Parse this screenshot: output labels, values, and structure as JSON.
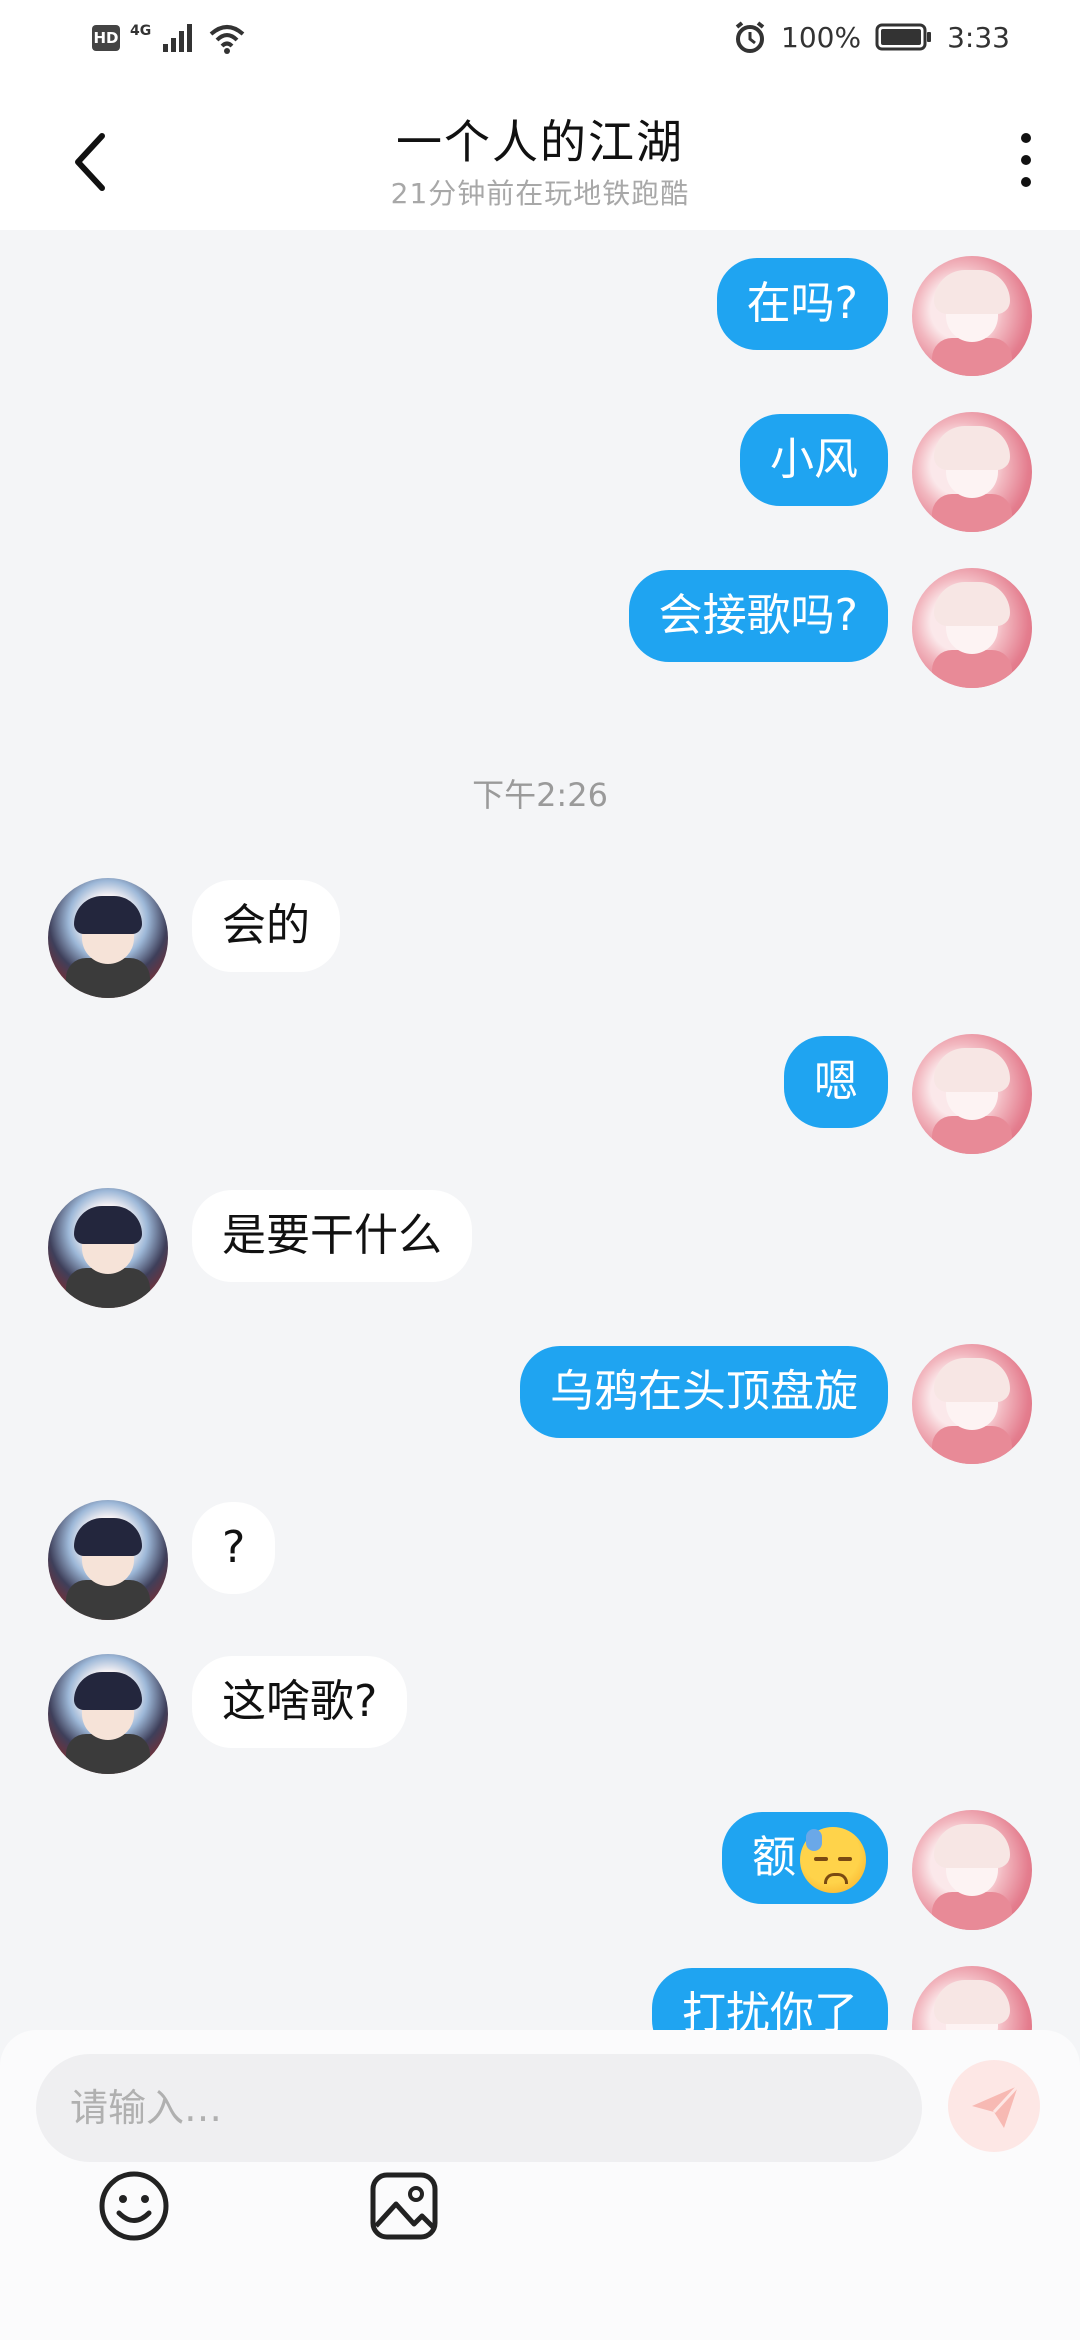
{
  "status_bar": {
    "hd": "HD",
    "network": "4G",
    "battery": "100%",
    "time": "3:33"
  },
  "header": {
    "title": "一个人的江湖",
    "subtitle": "21分钟前在玩地铁跑酷"
  },
  "messages": [
    {
      "side": "self",
      "text": "在吗?"
    },
    {
      "side": "self",
      "text": "小风"
    },
    {
      "side": "self",
      "text": "会接歌吗?"
    },
    {
      "side": "peer",
      "text": "会的"
    },
    {
      "side": "self",
      "text": "嗯"
    },
    {
      "side": "peer",
      "text": "是要干什么"
    },
    {
      "side": "self",
      "text": "乌鸦在头顶盘旋"
    },
    {
      "side": "peer",
      "text": "?"
    },
    {
      "side": "peer",
      "text": "这啥歌?"
    },
    {
      "side": "self",
      "text": "额",
      "emoji": "sweat-face-icon"
    },
    {
      "side": "self",
      "text": "打扰你了"
    }
  ],
  "timestamp": "下午2:26",
  "input": {
    "placeholder": "请输入…"
  },
  "icons": {
    "back": "back-arrow-icon",
    "more": "more-vertical-icon",
    "send": "send-icon",
    "emoji": "smiley-icon",
    "image": "image-icon"
  },
  "colors": {
    "self_bubble": "#1fa4f1",
    "peer_bubble": "#ffffff",
    "background": "#f4f5f7"
  }
}
